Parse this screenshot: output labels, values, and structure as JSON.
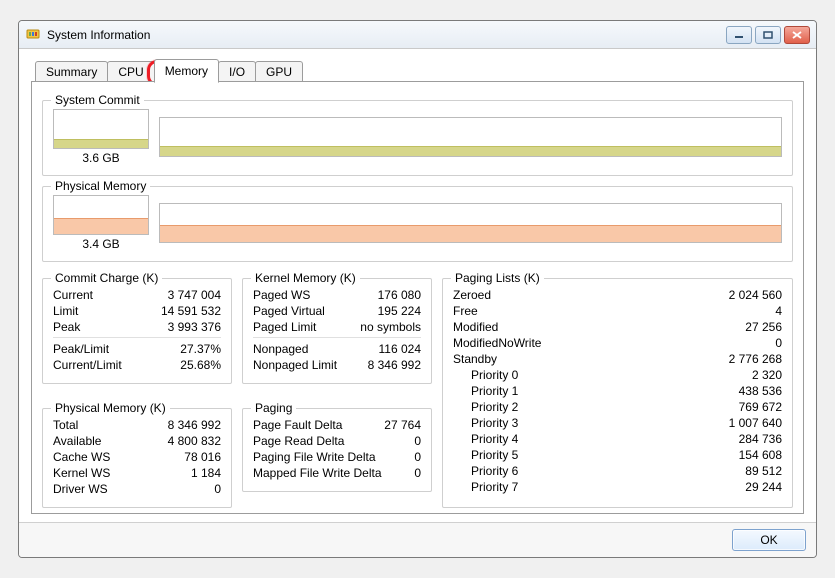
{
  "title": "System Information",
  "tabs": [
    "Summary",
    "CPU",
    "Memory",
    "I/O",
    "GPU"
  ],
  "active_tab": 2,
  "system_commit": {
    "label": "System Commit",
    "value": "3.6 GB"
  },
  "physical_memory": {
    "label": "Physical Memory",
    "value": "3.4 GB"
  },
  "commit_charge": {
    "label": "Commit Charge (K)",
    "rows": [
      {
        "k": "Current",
        "v": "3 747 004"
      },
      {
        "k": "Limit",
        "v": "14 591 532"
      },
      {
        "k": "Peak",
        "v": "3 993 376"
      },
      {
        "k": "Peak/Limit",
        "v": "27.37%"
      },
      {
        "k": "Current/Limit",
        "v": "25.68%"
      }
    ]
  },
  "phys_mem": {
    "label": "Physical Memory (K)",
    "rows": [
      {
        "k": "Total",
        "v": "8 346 992"
      },
      {
        "k": "Available",
        "v": "4 800 832"
      },
      {
        "k": "Cache WS",
        "v": "78 016"
      },
      {
        "k": "Kernel WS",
        "v": "1 184"
      },
      {
        "k": "Driver WS",
        "v": "0"
      }
    ]
  },
  "kernel_mem": {
    "label": "Kernel Memory (K)",
    "rows": [
      {
        "k": "Paged WS",
        "v": "176 080"
      },
      {
        "k": "Paged Virtual",
        "v": "195 224"
      },
      {
        "k": "Paged Limit",
        "v": "no symbols"
      },
      {
        "k": "Nonpaged",
        "v": "116 024"
      },
      {
        "k": "Nonpaged Limit",
        "v": "8 346 992"
      }
    ]
  },
  "paging": {
    "label": "Paging",
    "rows": [
      {
        "k": "Page Fault Delta",
        "v": "27 764"
      },
      {
        "k": "Page Read Delta",
        "v": "0"
      },
      {
        "k": "Paging File Write Delta",
        "v": "0"
      },
      {
        "k": "Mapped File Write Delta",
        "v": "0"
      }
    ]
  },
  "paging_lists": {
    "label": "Paging Lists (K)",
    "rows": [
      {
        "k": "Zeroed",
        "v": "2 024 560"
      },
      {
        "k": "Free",
        "v": "4"
      },
      {
        "k": "Modified",
        "v": "27 256"
      },
      {
        "k": "ModifiedNoWrite",
        "v": "0"
      },
      {
        "k": "Standby",
        "v": "2 776 268"
      },
      {
        "k": "Priority 0",
        "v": "2 320"
      },
      {
        "k": "Priority 1",
        "v": "438 536"
      },
      {
        "k": "Priority 2",
        "v": "769 672"
      },
      {
        "k": "Priority 3",
        "v": "1 007 640"
      },
      {
        "k": "Priority 4",
        "v": "284 736"
      },
      {
        "k": "Priority 5",
        "v": "154 608"
      },
      {
        "k": "Priority 6",
        "v": "89 512"
      },
      {
        "k": "Priority 7",
        "v": "29 244"
      }
    ]
  },
  "buttons": {
    "ok": "OK"
  },
  "chart_data": [
    {
      "type": "area",
      "title": "System Commit",
      "values_label": "3.6 GB",
      "ylim": [
        0,
        14.6
      ],
      "xlabel": "",
      "ylabel": "",
      "series": [
        {
          "name": "commit",
          "values": [
            3.6
          ]
        }
      ]
    },
    {
      "type": "area",
      "title": "Physical Memory",
      "values_label": "3.4 GB",
      "ylim": [
        0,
        8.0
      ],
      "xlabel": "",
      "ylabel": "",
      "series": [
        {
          "name": "used",
          "values": [
            3.4
          ]
        }
      ]
    }
  ]
}
